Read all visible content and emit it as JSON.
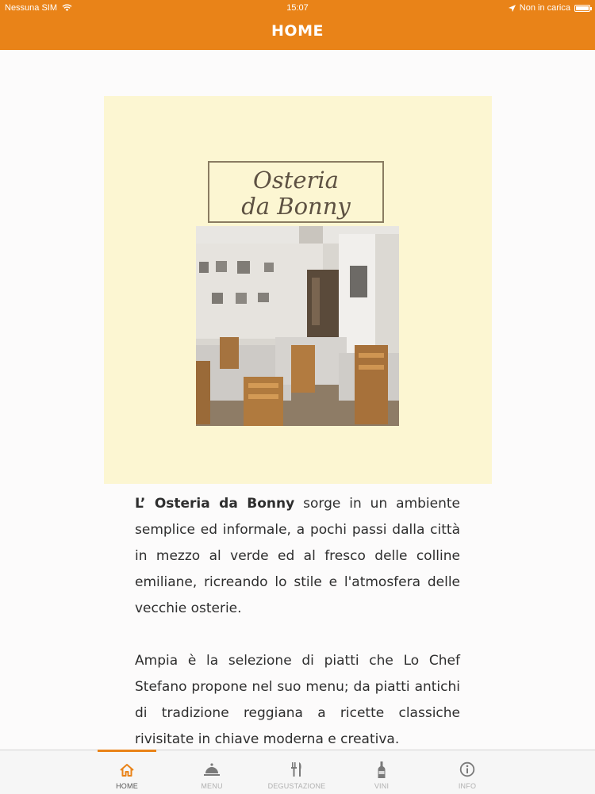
{
  "status_bar": {
    "carrier": "Nessuna SIM",
    "time": "15:07",
    "charging": "Non in carica",
    "icons": [
      "wifi-icon",
      "location-arrow-icon",
      "battery-icon"
    ]
  },
  "header": {
    "title": "HOME"
  },
  "hero": {
    "sign_line1": "Osteria",
    "sign_line2": "da Bonny"
  },
  "content": {
    "p1_bold": "L’ Osteria da Bonny",
    "p1_rest": " sorge in un ambiente semplice ed informale, a pochi passi dalla città in mezzo al verde ed al fresco delle colline emiliane, ricreando lo stile e l'atmosfera delle vecchie osterie.",
    "p2": "Ampia è la selezione di piatti che Lo Chef Stefano propone nel suo menu; da piatti antichi di tradizione reggiana a ricette classiche rivisitate in chiave moderna e creativa."
  },
  "tabbar": {
    "accent": "#e98318",
    "tabs": [
      {
        "label": "HOME",
        "icon": "home-icon",
        "active": true
      },
      {
        "label": "MENU",
        "icon": "cloche-icon",
        "active": false
      },
      {
        "label": "DEGUSTAZIONE",
        "icon": "fork-knife-icon",
        "active": false
      },
      {
        "label": "VINI",
        "icon": "wine-bottle-icon",
        "active": false
      },
      {
        "label": "INFO",
        "icon": "info-icon",
        "active": false
      }
    ]
  }
}
